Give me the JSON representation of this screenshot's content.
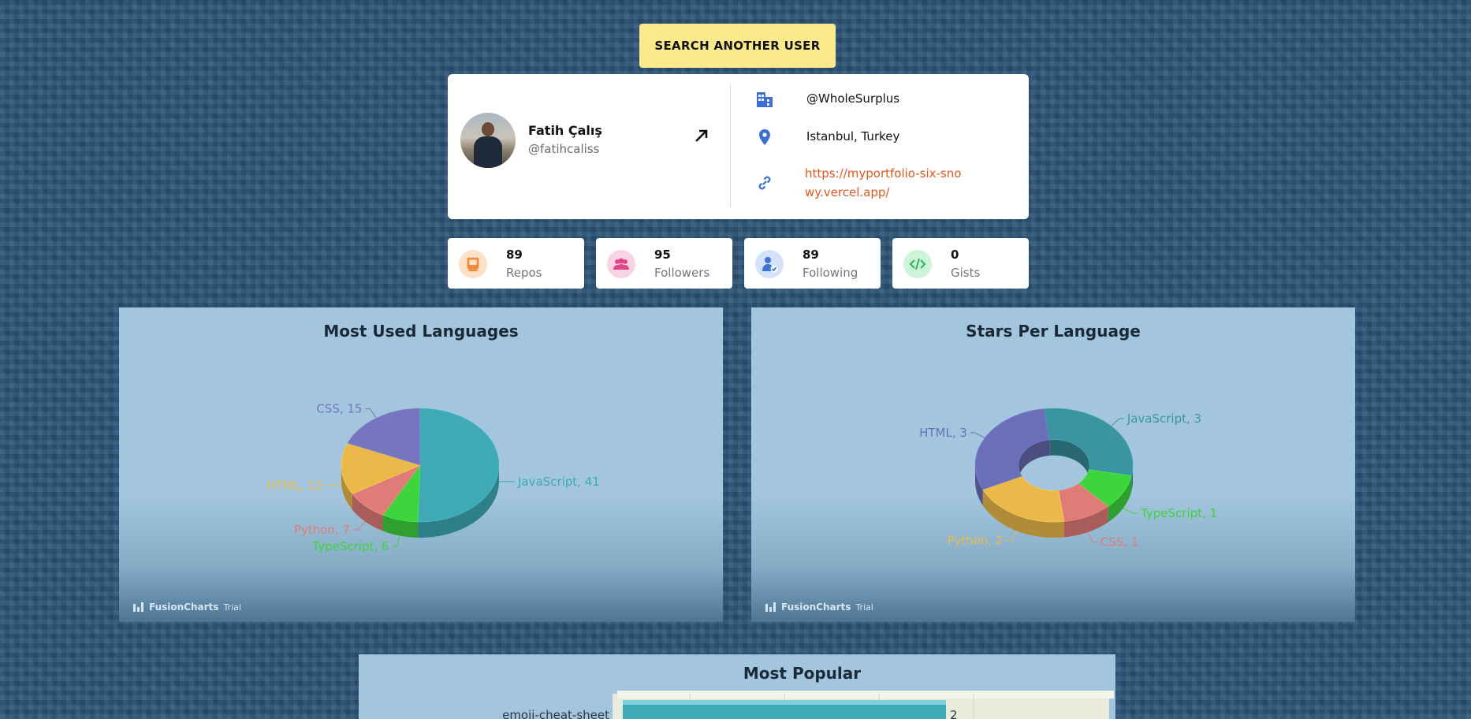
{
  "search_button": "SEARCH ANOTHER USER",
  "user": {
    "name": "Fatih Çalış",
    "login": "@fatihcaliss",
    "company": "@WholeSurplus",
    "location": "Istanbul, Turkey",
    "blog": "https://myportfolio-six-snowy.vercel.app/"
  },
  "stats": [
    {
      "value": "89",
      "label": "Repos",
      "icon": "book-icon",
      "color": "#f18a3a",
      "bg": "#fde0c8"
    },
    {
      "value": "95",
      "label": "Followers",
      "icon": "people-icon",
      "color": "#e0468a",
      "bg": "#f8d3e4"
    },
    {
      "value": "89",
      "label": "Following",
      "icon": "user-check-icon",
      "color": "#3b73d6",
      "bg": "#d3e2fa"
    },
    {
      "value": "0",
      "label": "Gists",
      "icon": "code-icon",
      "color": "#2bb35a",
      "bg": "#cdf3d8"
    }
  ],
  "charts": {
    "languages_title": "Most Used Languages",
    "stars_title": "Stars Per Language",
    "popular_title": "Most Popular",
    "credit": "FusionCharts",
    "credit_trial": "Trial"
  },
  "chart_data": [
    {
      "type": "pie",
      "title": "Most Used Languages",
      "categories": [
        "JavaScript",
        "TypeScript",
        "Python",
        "HTML",
        "CSS"
      ],
      "values": [
        41,
        6,
        7,
        12,
        15
      ],
      "colors": [
        "#3fa9b6",
        "#3ed43e",
        "#e07c78",
        "#eab94a",
        "#7576bd"
      ]
    },
    {
      "type": "pie",
      "title": "Stars Per Language",
      "categories": [
        "JavaScript",
        "TypeScript",
        "CSS",
        "Python",
        "HTML"
      ],
      "values": [
        3,
        1,
        1,
        2,
        3
      ],
      "colors": [
        "#3b95a0",
        "#3ed43e",
        "#e07c78",
        "#eab94a",
        "#6b6fb8"
      ]
    },
    {
      "type": "bar",
      "title": "Most Popular",
      "categories": [
        "emoji-cheat-sheet"
      ],
      "values": [
        2
      ]
    }
  ]
}
